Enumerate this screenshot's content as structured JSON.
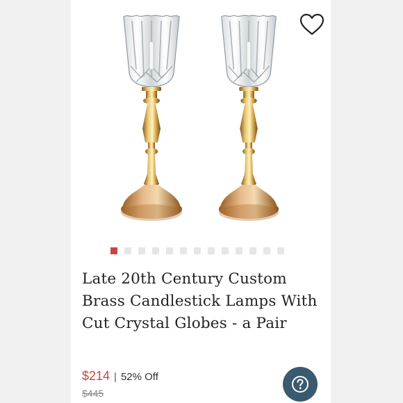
{
  "listing": {
    "title": "Late 20th Century Custom Brass Candlestick Lamps With Cut Crystal Globes - a Pair",
    "price": "$214",
    "separator": "|",
    "discount": "52% Off",
    "original_price": "$445"
  },
  "gallery": {
    "image_count": 13,
    "active_index": 0,
    "active_color": "#c8473d",
    "inactive_color": "#e6e6e6"
  },
  "icons": {
    "like": "heart-outline-icon",
    "help": "question-mark-icon"
  },
  "colors": {
    "accent": "#c8473d",
    "help_button": "#3a5a70",
    "brass": "#c9a24a",
    "background": "#ffffff"
  }
}
